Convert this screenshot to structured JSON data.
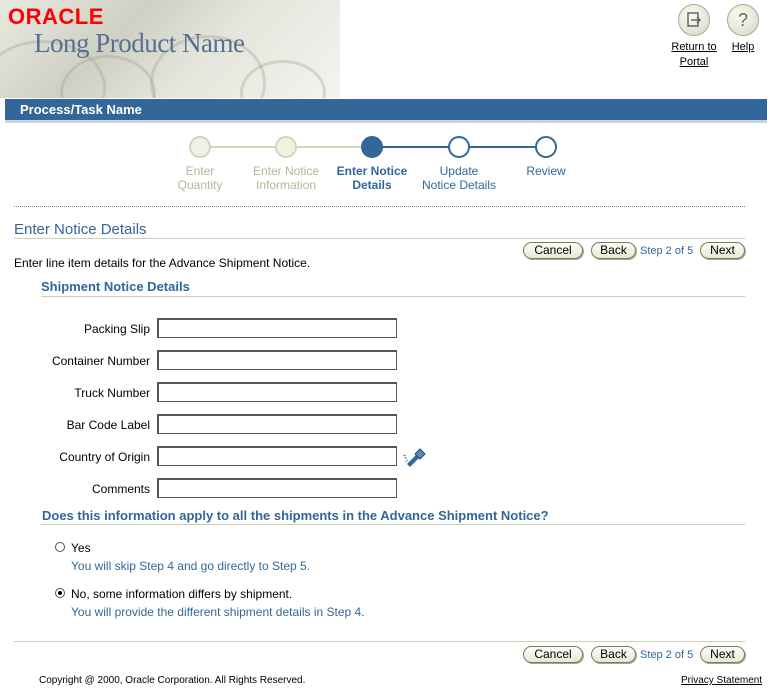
{
  "header": {
    "brand": "ORACLE",
    "product_name": "Long Product Name",
    "global_buttons": {
      "return_line1": "Return to",
      "return_line2": "Portal",
      "help": "Help"
    }
  },
  "process_title": "Process/Task Name",
  "train": {
    "steps": [
      {
        "line1": "Enter",
        "line2": "Quantity",
        "state": "visited"
      },
      {
        "line1": "Enter Notice",
        "line2": "Information",
        "state": "visited"
      },
      {
        "line1": "Enter Notice",
        "line2": "Details",
        "state": "current"
      },
      {
        "line1": "Update",
        "line2": "Notice Details",
        "state": "next"
      },
      {
        "line1": "Review",
        "line2": "",
        "state": "next"
      }
    ]
  },
  "page": {
    "title": "Enter Notice Details",
    "instruction": "Enter line item details for the Advance Shipment Notice.",
    "subheading": "Shipment Notice Details",
    "question": "Does this information apply to all the shipments in the Advance Shipment Notice?"
  },
  "nav": {
    "cancel": "Cancel",
    "back": "Back",
    "step": "Step 2 of 5",
    "next": "Next"
  },
  "form": {
    "packing_slip_label": "Packing Slip",
    "packing_slip_value": "",
    "container_number_label": "Container Number",
    "container_number_value": "",
    "truck_number_label": "Truck Number",
    "truck_number_value": "",
    "bar_code_label": "Bar Code Label",
    "bar_code_value": "",
    "country_of_origin_label": "Country of Origin",
    "country_of_origin_value": "",
    "comments_label": "Comments",
    "comments_value": ""
  },
  "options": {
    "yes_label": "Yes",
    "yes_help": "You will skip Step 4 and go directly to Step 5.",
    "yes_selected": false,
    "no_label": "No, some information differs by shipment.",
    "no_help": "You will provide the different shipment details in Step 4.",
    "no_selected": true
  },
  "footer": {
    "copyright": "Copyright @ 2000, Oracle Corporation. All Rights Reserved.",
    "privacy": "Privacy Statement"
  },
  "colors": {
    "brand_blue": "#336699",
    "oracle_red": "#ff0000",
    "visited_step": "#b5b59a"
  },
  "icons": {
    "return_to_portal": "portal-icon",
    "help": "help-icon",
    "lov": "flashlight-icon"
  }
}
